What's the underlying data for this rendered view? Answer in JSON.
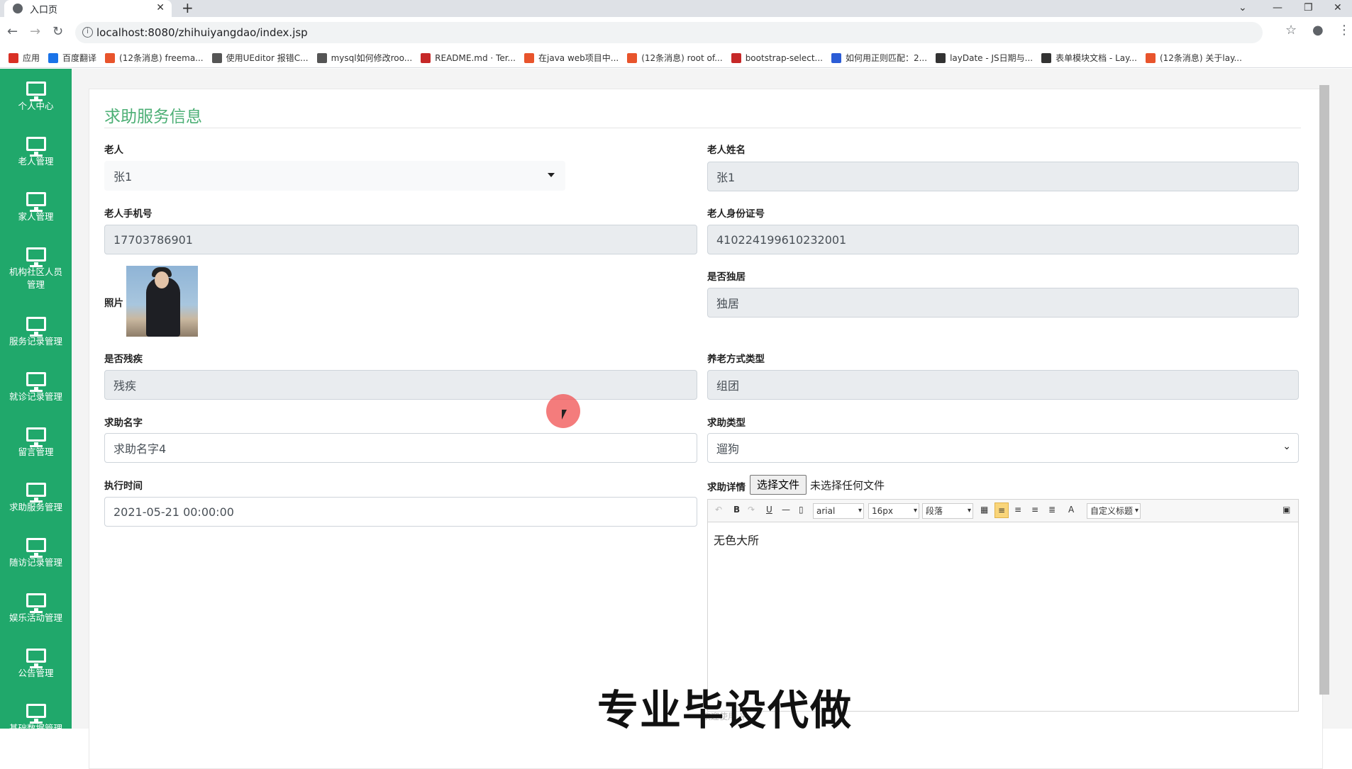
{
  "browser": {
    "tab_title": "入口页",
    "url": "localhost:8080/zhihuiyangdao/index.jsp",
    "bookmarks": [
      {
        "label": "应用",
        "color": "#d93025"
      },
      {
        "label": "百度翻译",
        "color": "#1a73e8"
      },
      {
        "label": "(12条消息) freema...",
        "color": "#e8542c"
      },
      {
        "label": "使用UEditor 报错C...",
        "color": "#555555"
      },
      {
        "label": "mysql如何修改roo...",
        "color": "#555555"
      },
      {
        "label": "README.md · Ter...",
        "color": "#c62828"
      },
      {
        "label": "在java web项目中...",
        "color": "#e8542c"
      },
      {
        "label": "(12条消息) root of...",
        "color": "#e8542c"
      },
      {
        "label": "bootstrap-select...",
        "color": "#c62828"
      },
      {
        "label": "如何用正则匹配：2...",
        "color": "#2b5cd6"
      },
      {
        "label": "layDate - JS日期与...",
        "color": "#333333"
      },
      {
        "label": "表单模块文档 - Lay...",
        "color": "#333333"
      },
      {
        "label": "(12条消息) 关于lay...",
        "color": "#e8542c"
      }
    ]
  },
  "sidebar": {
    "items": [
      {
        "label": "个人中心"
      },
      {
        "label": "老人管理"
      },
      {
        "label": "家人管理"
      },
      {
        "label": "机构社区人员管理"
      },
      {
        "label": "服务记录管理"
      },
      {
        "label": "就诊记录管理"
      },
      {
        "label": "留言管理"
      },
      {
        "label": "求助服务管理"
      },
      {
        "label": "随访记录管理"
      },
      {
        "label": "娱乐活动管理"
      },
      {
        "label": "公告管理"
      },
      {
        "label": "基础数据管理"
      }
    ]
  },
  "form": {
    "title": "求助服务信息",
    "elder_label": "老人",
    "elder_value": "张1",
    "elder_name_label": "老人姓名",
    "elder_name_value": "张1",
    "phone_label": "老人手机号",
    "phone_value": "17703786901",
    "idcard_label": "老人身份证号",
    "idcard_value": "410224199610232001",
    "photo_label": "照片",
    "alone_label": "是否独居",
    "alone_value": "独居",
    "disabled_label": "是否残疾",
    "disabled_value": "残疾",
    "care_type_label": "养老方式类型",
    "care_type_value": "组团",
    "help_name_label": "求助名字",
    "help_name_value": "求助名字4",
    "help_type_label": "求助类型",
    "help_type_value": "遛狗",
    "exec_time_label": "执行时间",
    "exec_time_value": "2021-05-21 00:00:00",
    "detail_label": "求助详情",
    "file_button": "选择文件",
    "file_status": "未选择任何文件",
    "editor": {
      "font_family": "arial",
      "font_size": "16px",
      "paragraph": "段落",
      "custom_title": "自定义标题",
      "bold": "B",
      "underline": "U",
      "color_a": "A",
      "content": "无色大所"
    }
  },
  "overlay": {
    "watermark": "专业毕设代做",
    "footer_faint": "欢迎使用 平"
  },
  "colors": {
    "sidebar": "#20a86b",
    "title": "#4caf75"
  }
}
